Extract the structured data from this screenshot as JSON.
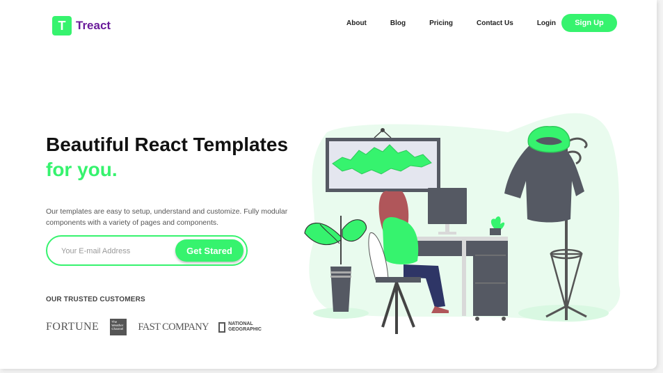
{
  "brand": {
    "logo_letter": "T",
    "name": "Treact"
  },
  "nav": {
    "items": [
      "About",
      "Blog",
      "Pricing",
      "Contact Us",
      "Login"
    ],
    "signup_label": "Sign Up"
  },
  "hero": {
    "title_line1": "Beautiful React Templates",
    "title_line2": "for you.",
    "description": "Our templates are easy to setup, understand and customize. Fully modular components with a variety of pages and components.",
    "email_placeholder": "Your E-mail Address",
    "cta_label": "Get Stared"
  },
  "customers": {
    "heading": "OUR TRUSTED CUSTOMERS",
    "logos": [
      {
        "name": "fortune-logo",
        "text": "FORTUNE"
      },
      {
        "name": "weather-channel-logo",
        "text": "The Weather Channel"
      },
      {
        "name": "fast-company-logo",
        "text": "FAST COMPANY"
      },
      {
        "name": "national-geographic-logo",
        "text": "NATIONAL GEOGRAPHIC"
      }
    ]
  },
  "colors": {
    "accent": "#36f36e",
    "brand_text": "#6a1b9a",
    "heading": "#111111",
    "body_text": "#555555"
  },
  "illustration": {
    "icon": "person-working-at-desk-illustration"
  }
}
